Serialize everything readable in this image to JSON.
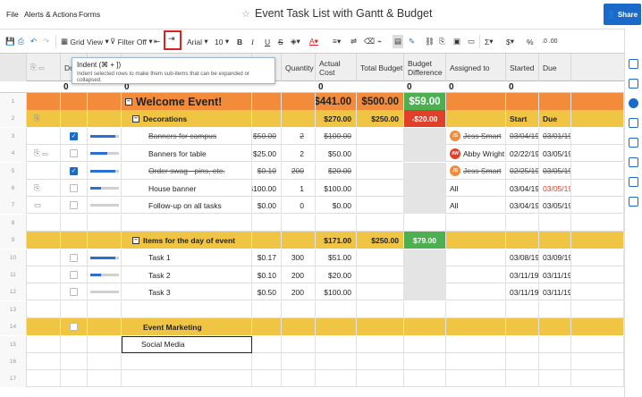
{
  "menu": [
    "File",
    "Alerts & Actions",
    "Forms"
  ],
  "title": "Event Task List with Gantt & Budget",
  "share_label": "Share",
  "toolbar": {
    "grid_view": "Grid View",
    "filter": "Filter Off",
    "font": "Arial",
    "font_size": "10",
    "bold": "B",
    "italic": "I",
    "underline": "U",
    "strike": "S",
    "sum": "Σ",
    "currency": "$",
    "percent": "%",
    "decimals": ".0 .00"
  },
  "tooltip": {
    "title": "Indent (⌘ + ])",
    "desc": "Indent selected rows to make them sub-items that can be expanded or collapsed."
  },
  "columns": {
    "done": "Do",
    "quantity": "Quantity",
    "actual_cost": "Actual Cost",
    "total_budget": "Total Budget",
    "budget_diff_1": "Budget",
    "budget_diff_2": "Difference",
    "assigned": "Assigned to",
    "started": "Started",
    "due": "Due"
  },
  "summary_zero": "0",
  "rows": [
    {
      "num": "1",
      "type": "top",
      "name": "Welcome Event!",
      "actual": "$441.00",
      "budget": "$500.00",
      "diff": "$59.00"
    },
    {
      "num": "2",
      "type": "section",
      "name": "Decorations",
      "actual": "$270.00",
      "budget": "$250.00",
      "diff": "-$20.00",
      "started": "Start",
      "due": "Due"
    },
    {
      "num": "3",
      "done": true,
      "progress": 0.9,
      "name": "Banners for campus",
      "strike": true,
      "unit": "$50.00",
      "qty": "2",
      "actual": "$100.00",
      "avatar": "JS",
      "assigned": "Jess Smart",
      "started": "03/04/19",
      "due": "03/01/19"
    },
    {
      "num": "4",
      "done": false,
      "progress": 0.6,
      "name": "Banners for table",
      "unit": "$25.00",
      "qty": "2",
      "actual": "$50.00",
      "avatar": "AW",
      "assigned": "Abby Wright",
      "started": "02/22/19",
      "due": "03/05/19"
    },
    {
      "num": "5",
      "done": true,
      "progress": 0.9,
      "name": "Order swag - pins, etc.",
      "strike": true,
      "unit": "$0.10",
      "qty": "200",
      "actual": "$20.00",
      "avatar": "JS",
      "assigned": "Jess Smart",
      "started": "02/25/19",
      "due": "03/05/19"
    },
    {
      "num": "6",
      "done": false,
      "progress": 0.4,
      "name": "House banner",
      "unit": "$100.00",
      "qty": "1",
      "actual": "$100.00",
      "assigned": "All",
      "started": "03/04/19",
      "due": "03/05/19",
      "due_red": true
    },
    {
      "num": "7",
      "done": false,
      "progress": 0.0,
      "name": "Follow-up on all tasks",
      "unit": "$0.00",
      "qty": "0",
      "actual": "$0.00",
      "assigned": "All",
      "started": "03/04/19",
      "due": "03/05/19"
    },
    {
      "num": "8",
      "type": "blank"
    },
    {
      "num": "9",
      "type": "section",
      "name": "Items for the day of event",
      "actual": "$171.00",
      "budget": "$250.00",
      "diff": "$79.00"
    },
    {
      "num": "10",
      "done": false,
      "progress": 0.9,
      "name": "Task 1",
      "unit": "$0.17",
      "qty": "300",
      "actual": "$51.00",
      "started": "03/08/19",
      "due": "03/09/19"
    },
    {
      "num": "11",
      "done": false,
      "progress": 0.4,
      "name": "Task 2",
      "unit": "$0.10",
      "qty": "200",
      "actual": "$20.00",
      "started": "03/11/19",
      "due": "03/11/19"
    },
    {
      "num": "12",
      "done": false,
      "progress": 0.0,
      "name": "Task 3",
      "unit": "$0.50",
      "qty": "200",
      "actual": "$100.00",
      "started": "03/11/19",
      "due": "03/11/19"
    },
    {
      "num": "13",
      "type": "blank"
    },
    {
      "num": "14",
      "type": "section2",
      "name": "Event Marketing"
    },
    {
      "num": "15",
      "type": "edit",
      "name": "Social Media"
    },
    {
      "num": "16",
      "type": "blank"
    },
    {
      "num": "17",
      "type": "blank"
    }
  ],
  "colors": {
    "orange": "#f28c3b",
    "yellow": "#f0c543",
    "green": "#4cb050",
    "red": "#e0402a",
    "blue": "#1b6ac9"
  }
}
